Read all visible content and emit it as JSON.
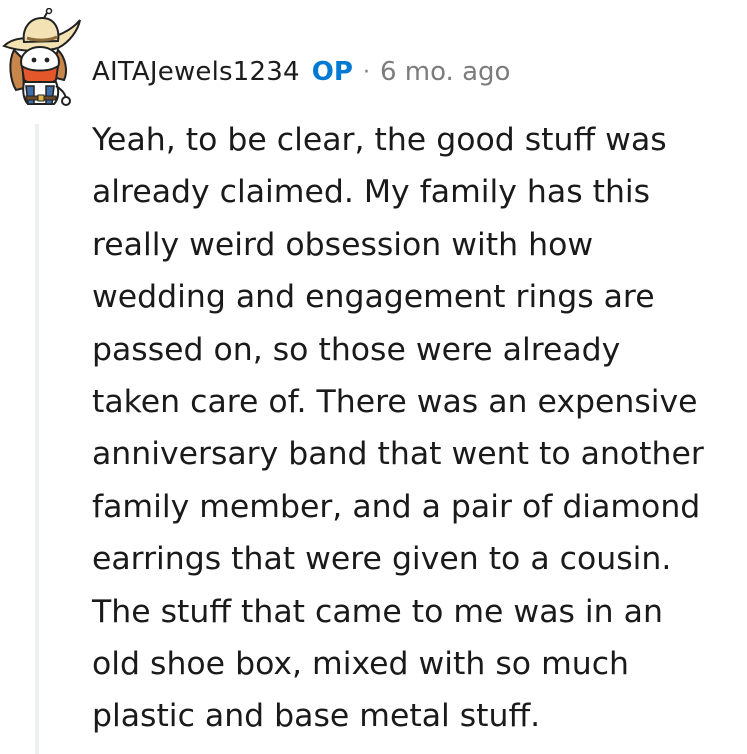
{
  "comment": {
    "author": "AITAJewels1234",
    "op_badge": "OP",
    "separator": "·",
    "time_ago": "6 mo. ago",
    "body_lines": [
      "Yeah, to be clear, the good stuff was",
      "already claimed. My family has this",
      "really weird obsession with how",
      "wedding and engagement rings are",
      "passed on, so those were already",
      "taken care of. There was an expensive",
      "anniversary band that went to another",
      "family member, and a pair of diamond",
      "earrings that were given to a cousin.",
      "The stuff that came to me was in an",
      "old shoe box, mixed with so much",
      "plastic and base metal stuff."
    ]
  },
  "colors": {
    "op_blue": "#0079d3",
    "meta_gray": "#7c7c7c",
    "text": "#1a1a1b",
    "thread_line": "#edeff1"
  },
  "icons": {
    "avatar": "cowboy-snoo-avatar"
  }
}
